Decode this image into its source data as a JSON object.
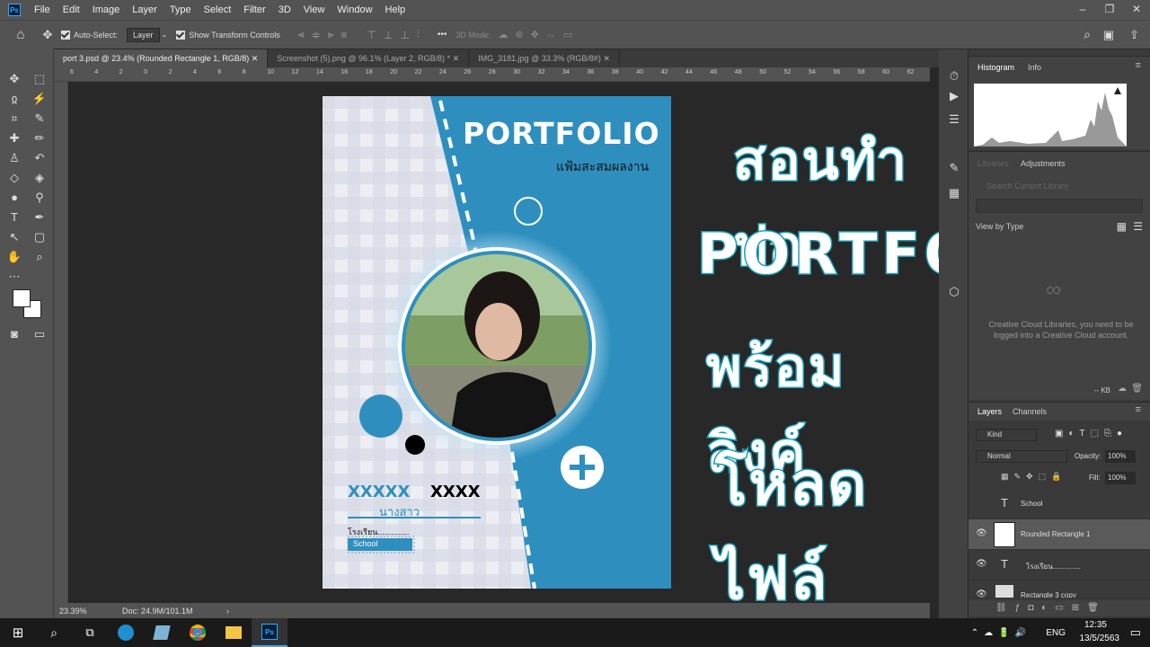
{
  "menubar": {
    "app_badge": "Ps",
    "items": [
      "File",
      "Edit",
      "Image",
      "Layer",
      "Type",
      "Select",
      "Filter",
      "3D",
      "View",
      "Window",
      "Help"
    ],
    "window_controls": [
      "–",
      "❐",
      "✕"
    ]
  },
  "options": {
    "auto_select_label": "Auto-Select:",
    "auto_select_value": "Layer",
    "show_transform_label": "Show Transform Controls",
    "mode_3d_label": "3D Mode:",
    "more": "•••"
  },
  "tabs": [
    {
      "label": "port 3.psd @ 23.4% (Rounded Rectangle 1, RGB/8)",
      "close": "✕"
    },
    {
      "label": "Screenshot (5).png @ 96.1% (Layer 2, RGB/8) *",
      "close": "✕"
    },
    {
      "label": "IMG_3181.jpg @ 33.3% (RGB/8#)",
      "close": "✕"
    }
  ],
  "ruler_h": [
    "6",
    "4",
    "2",
    "0",
    "2",
    "4",
    "6",
    "8",
    "10",
    "12",
    "14",
    "16",
    "18",
    "20",
    "22",
    "24",
    "26",
    "28",
    "30",
    "32",
    "34",
    "36",
    "38",
    "40",
    "42",
    "44",
    "46",
    "48",
    "50",
    "52",
    "54",
    "56",
    "58",
    "60",
    "62"
  ],
  "status": {
    "zoom": "23.39%",
    "doc": "Doc: 24.9M/101.1M",
    "arrow": "›"
  },
  "document": {
    "title": "PORTFOLIO",
    "subtitle": "แฟ้มสะสมผลงาน",
    "name_first": "XXXXX",
    "name_last": "XXXX",
    "prefix": "นางสาว",
    "school_label": "โรงเรียน..............",
    "school_value": "School",
    "plus": "+",
    "colors": {
      "blue": "#2e8fbf",
      "check": "#e4e6ee"
    }
  },
  "overlay": {
    "line1": "สอนทำปก",
    "line2": "PORTFOLIO",
    "line3": "พร้อมลิงค์",
    "line4": "โหลดไฟล์"
  },
  "panels": {
    "histogram_tab": "Histogram",
    "info_tab": "Info",
    "libraries_tab": "Libraries",
    "adjustments_tab": "Adjustments",
    "search_placeholder": "Search Current Library",
    "view_by": "View by Type",
    "cc_message": "Creative Cloud Libraries, you need to be logged into a Creative Cloud account.",
    "kb": "-- KB",
    "layers_tab": "Layers",
    "channels_tab": "Channels",
    "kind": "Kind",
    "blend": "Normal",
    "opacity_label": "Opacity:",
    "opacity_value": "100%",
    "lock_label": "Lock:",
    "fill_label": "Fill:",
    "fill_value": "100%",
    "layers": [
      "School",
      "Rounded Rectangle 1",
      "โรงเรียน..............",
      "Rectangle 3 copy"
    ]
  },
  "taskbar": {
    "lang": "ENG",
    "time": "12:35",
    "date": "13/5/2563"
  }
}
